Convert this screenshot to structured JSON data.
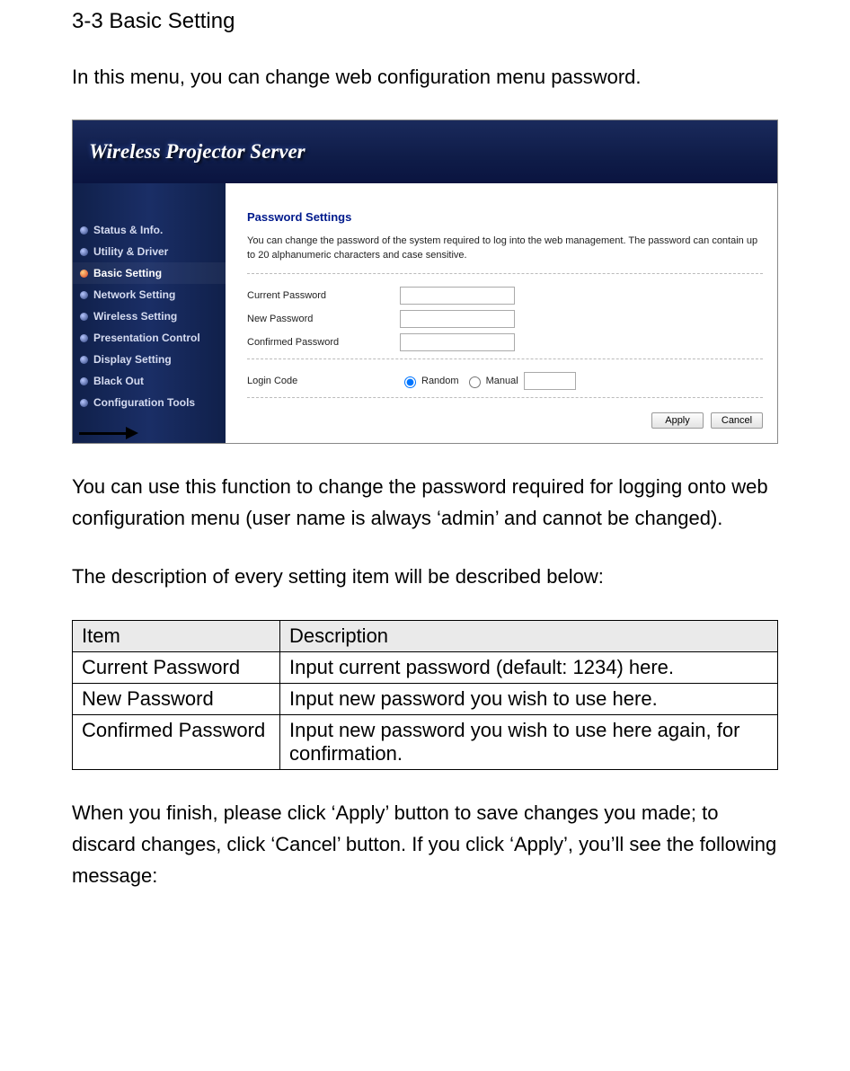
{
  "doc": {
    "section_title": "3-3 Basic Setting",
    "intro": "In this menu, you can change web configuration menu password.",
    "body1": "You can use this function to change the password required for logging onto web configuration menu (user name is always ‘admin’ and cannot be changed).",
    "body2": "The description of every setting item will be described below:",
    "body3": "When you finish, please click ‘Apply’ button to save changes you made; to discard changes, click ‘Cancel’ button. If you click ‘Apply’, you’ll see the following message:"
  },
  "screenshot": {
    "header_title": "Wireless Projector Server",
    "nav": [
      {
        "label": "Status & Info."
      },
      {
        "label": "Utility & Driver"
      },
      {
        "label": "Basic Setting",
        "active": true
      },
      {
        "label": "Network Setting"
      },
      {
        "label": "Wireless Setting"
      },
      {
        "label": "Presentation Control"
      },
      {
        "label": "Display Setting"
      },
      {
        "label": "Black Out"
      },
      {
        "label": "Configuration Tools"
      }
    ],
    "panel": {
      "heading": "Password Settings",
      "tagline": "You can change the password of the system required to log into the web management. The password can contain up to 20 alphanumeric characters and case sensitive.",
      "fields": {
        "current": "Current Password",
        "new": "New Password",
        "confirmed": "Confirmed Password",
        "login_code": "Login Code",
        "random": "Random",
        "manual": "Manual"
      },
      "buttons": {
        "apply": "Apply",
        "cancel": "Cancel"
      }
    }
  },
  "table": {
    "head": {
      "item": "Item",
      "desc": "Description"
    },
    "rows": [
      {
        "item": "Current Password",
        "desc": "Input current password (default: 1234) here."
      },
      {
        "item": "New Password",
        "desc": "Input new password you wish to use here."
      },
      {
        "item": "Confirmed Password",
        "desc": "Input new password you wish to use here again, for confirmation."
      }
    ]
  }
}
